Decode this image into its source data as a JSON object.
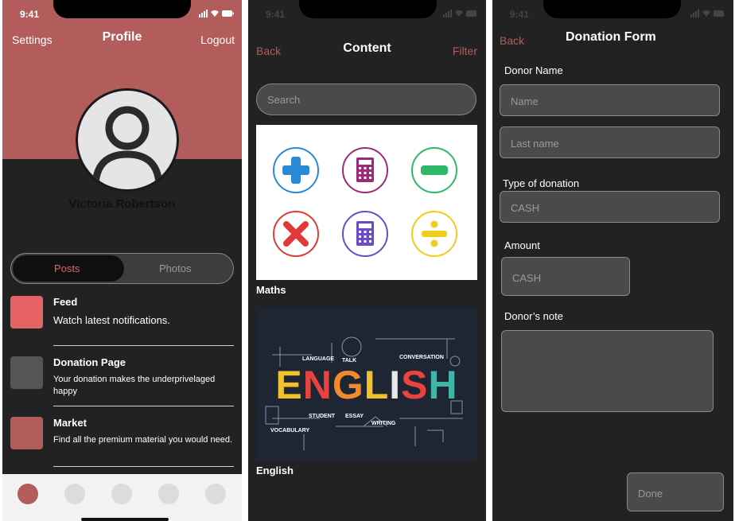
{
  "status": {
    "time": "9:41"
  },
  "profile": {
    "nav_left": "Settings",
    "title": "Profile",
    "nav_right": "Logout",
    "user_name": "Victoria Robertson",
    "segments": [
      "Posts",
      "Photos"
    ],
    "items": [
      {
        "title": "Feed",
        "desc": "Watch latest notifications.",
        "color": "#e56363"
      },
      {
        "title": "Donation Page",
        "desc": "Your donation makes the underprivelaged happy",
        "color": "#555555"
      },
      {
        "title": "Market",
        "desc": "Find all the premium material you would need.",
        "color": "#b25c5c"
      }
    ],
    "accent": "#b25c5c"
  },
  "content": {
    "nav_left": "Back",
    "title": "Content",
    "nav_right": "Filter",
    "search_placeholder": "Search",
    "cards": [
      {
        "caption": "Maths",
        "icons": [
          "plus-icon",
          "calculator-icon",
          "minus-icon",
          "multiply-icon",
          "calculator-icon",
          "divide-icon"
        ]
      },
      {
        "caption": "English",
        "heading_letters": [
          "E",
          "N",
          "G",
          "L",
          "I",
          "S",
          "H"
        ],
        "labels": [
          "LANGUAGE",
          "TALK",
          "CONVERSATION",
          "STUDENT",
          "ESSAY",
          "WRITING",
          "VOCABULARY"
        ]
      }
    ]
  },
  "donation": {
    "nav_left": "Back",
    "title": "Donation Form",
    "donor_name_label": "Donor Name",
    "name_placeholder": "Name",
    "lastname_placeholder": "Last name",
    "type_label": "Type of donation",
    "type_value": "CASH",
    "amount_label": "Amount",
    "amount_value": "CASH",
    "note_label": "Donor’s note",
    "done_label": "Done"
  }
}
